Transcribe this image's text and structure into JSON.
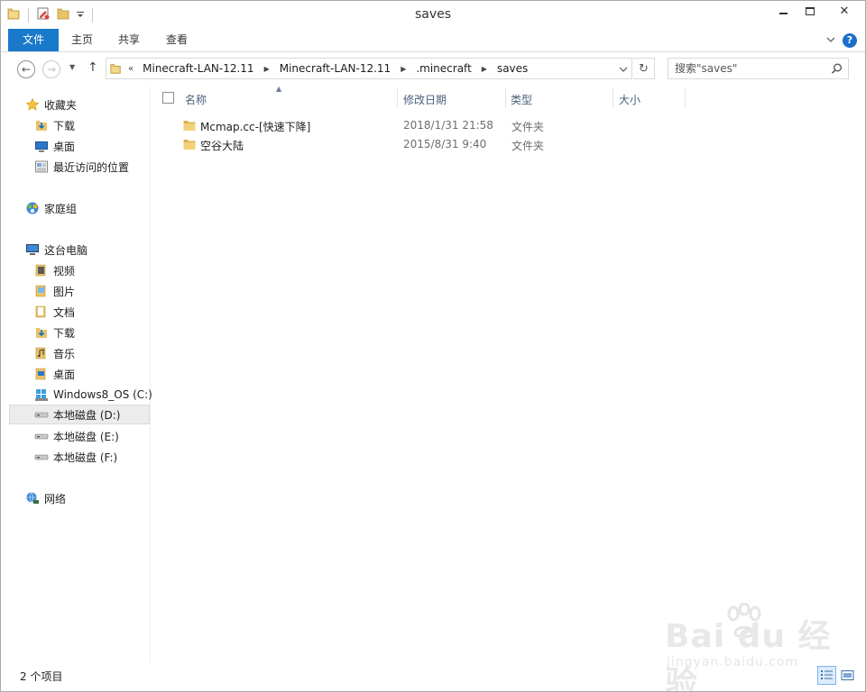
{
  "window": {
    "title": "saves"
  },
  "ribbon": {
    "tabs": [
      "文件",
      "主页",
      "共享",
      "查看"
    ],
    "help": "?"
  },
  "colors": {
    "accent": "#1979ca",
    "header_text": "#4c607a",
    "selection": "#ececec"
  },
  "address": {
    "overflow": "«",
    "crumbs": [
      "Minecraft-LAN-12.11",
      "Minecraft-LAN-12.11",
      ".minecraft",
      "saves"
    ]
  },
  "search": {
    "placeholder": "搜索\"saves\""
  },
  "nav": {
    "favorites": {
      "label": "收藏夹",
      "items": [
        "下载",
        "桌面",
        "最近访问的位置"
      ]
    },
    "homegroup": {
      "label": "家庭组"
    },
    "thispc": {
      "label": "这台电脑",
      "items": [
        "视频",
        "图片",
        "文档",
        "下载",
        "音乐",
        "桌面",
        "Windows8_OS (C:)",
        "本地磁盘 (D:)",
        "本地磁盘 (E:)",
        "本地磁盘 (F:)"
      ]
    },
    "network": {
      "label": "网络"
    }
  },
  "columns": {
    "name": "名称",
    "date": "修改日期",
    "type": "类型",
    "size": "大小"
  },
  "files": [
    {
      "name": "Mcmap.cc-[快速下降]",
      "date": "2018/1/31 21:58",
      "type": "文件夹",
      "size": ""
    },
    {
      "name": "空谷大陆",
      "date": "2015/8/31 9:40",
      "type": "文件夹",
      "size": ""
    }
  ],
  "status": {
    "count": "2 个项目"
  },
  "watermark": {
    "brand": "Bai du 经验",
    "sub": "jingyan.baidu.com"
  }
}
